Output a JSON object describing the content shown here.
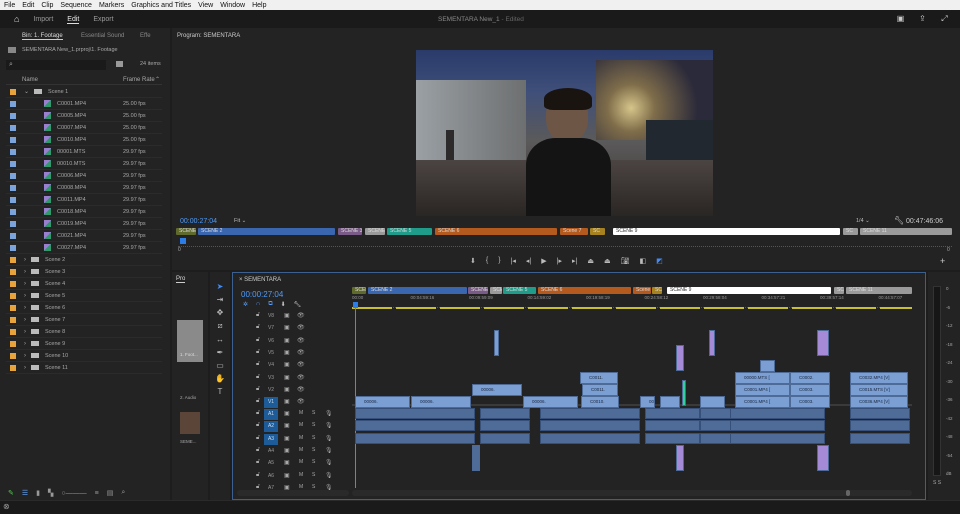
{
  "menu": [
    "File",
    "Edit",
    "Clip",
    "Sequence",
    "Markers",
    "Graphics and Titles",
    "View",
    "Window",
    "Help"
  ],
  "header": {
    "workspaces": [
      "Import",
      "Edit",
      "Export"
    ],
    "active": "Edit",
    "doc_title": "SEMENTARA New_1",
    "doc_status": "- Edited"
  },
  "project": {
    "tabs": [
      "Bin: 1. Footage",
      "Essential Sound",
      "Effe"
    ],
    "path": "SEMENTARA New_1.prproj\\1. Footage",
    "item_count": "24 items",
    "columns": {
      "name": "Name",
      "frame_rate": "Frame Rate"
    },
    "colors": {
      "folder": "#e8a33a",
      "clip": "#7ba4dc"
    },
    "items": [
      {
        "name": "Scene 1",
        "type": "folder",
        "open": true
      },
      {
        "name": "C0001.MP4",
        "fps": "25.00 fps"
      },
      {
        "name": "C0005.MP4",
        "fps": "25.00 fps"
      },
      {
        "name": "C0007.MP4",
        "fps": "25.00 fps"
      },
      {
        "name": "C0010.MP4",
        "fps": "25.00 fps"
      },
      {
        "name": "00001.MTS",
        "fps": "29.97 fps"
      },
      {
        "name": "00010.MTS",
        "fps": "29.97 fps"
      },
      {
        "name": "C0006.MP4",
        "fps": "29.97 fps"
      },
      {
        "name": "C0008.MP4",
        "fps": "29.97 fps"
      },
      {
        "name": "C0011.MP4",
        "fps": "29.97 fps"
      },
      {
        "name": "C0018.MP4",
        "fps": "29.97 fps"
      },
      {
        "name": "C0019.MP4",
        "fps": "29.97 fps"
      },
      {
        "name": "C0021.MP4",
        "fps": "29.97 fps"
      },
      {
        "name": "C0027.MP4",
        "fps": "29.97 fps"
      },
      {
        "name": "Scene 2",
        "type": "folder"
      },
      {
        "name": "Scene 3",
        "type": "folder"
      },
      {
        "name": "Scene 4",
        "type": "folder"
      },
      {
        "name": "Scene 5",
        "type": "folder"
      },
      {
        "name": "Scene 6",
        "type": "folder"
      },
      {
        "name": "Scene 7",
        "type": "folder"
      },
      {
        "name": "Scene 8",
        "type": "folder"
      },
      {
        "name": "Scene 9",
        "type": "folder"
      },
      {
        "name": "Scene 10",
        "type": "folder"
      },
      {
        "name": "Scene 11",
        "type": "folder"
      }
    ]
  },
  "program": {
    "title": "Program: SEMENTARA",
    "timecode": "00:00:27:04",
    "fit": "Fit",
    "resolution": "1/4",
    "duration": "00:47:46:06",
    "start": "0",
    "end": "0"
  },
  "scenes": [
    {
      "label": "SCENE 1",
      "color": "#5f6a2c"
    },
    {
      "label": "SCENE 2",
      "color": "#3a66b0"
    },
    {
      "label": "SCENE 3",
      "color": "#7a5a86"
    },
    {
      "label": "SCENE 4",
      "color": "#9a9a9a"
    },
    {
      "label": "SCENE 5",
      "color": "#1f9d8a"
    },
    {
      "label": "SCENE 6",
      "color": "#b45a1e"
    },
    {
      "label": "Scene 7",
      "color": "#b45a1e"
    },
    {
      "label": "SC",
      "color": "#a7821f"
    },
    {
      "label": "SCENE 9",
      "color": "#ffffff"
    },
    {
      "label": "SC",
      "color": "#9a9a9a"
    },
    {
      "label": "SCENE 11",
      "color": "#9a9a9a"
    }
  ],
  "mini_panel": {
    "tab": "Pro",
    "bins": [
      "1. Foot...",
      "2. Audio",
      "SEME..."
    ]
  },
  "timeline": {
    "sequence": "SEMENTARA",
    "timecode": "00:00:27:04",
    "ruler": [
      "00:00",
      "00:04:59:16",
      "00:09:59:09",
      "00:14:59:02",
      "00:19:58:19",
      "00:24:58:12",
      "00:29:58:04",
      "00:34:57:21",
      "00:39:57:14",
      "00:44:57:07"
    ],
    "video_tracks": [
      "V8",
      "V7",
      "V6",
      "V5",
      "V4",
      "V3",
      "V2",
      "V1"
    ],
    "audio_tracks": [
      "A1",
      "A2",
      "A3",
      "A4",
      "A5",
      "A6",
      "A7"
    ],
    "mute": "M",
    "solo": "S",
    "clip_labels": [
      "00006.",
      "C0011.",
      "C0010.",
      "00000.MTS [",
      "C0001.MP4 [",
      "C0001.MP4 [",
      "C0002.",
      "C0003.",
      "C0003.",
      "C0032.MP4 [V]",
      "C0015.MTS [V]",
      "C0036.MP4 [V]"
    ]
  },
  "meter": {
    "scale": [
      "0",
      "-6",
      "-12",
      "-18",
      "-24",
      "-30",
      "-36",
      "-42",
      "-48",
      "-54",
      "dB"
    ],
    "solo": "S S"
  },
  "zoom_value": "0"
}
